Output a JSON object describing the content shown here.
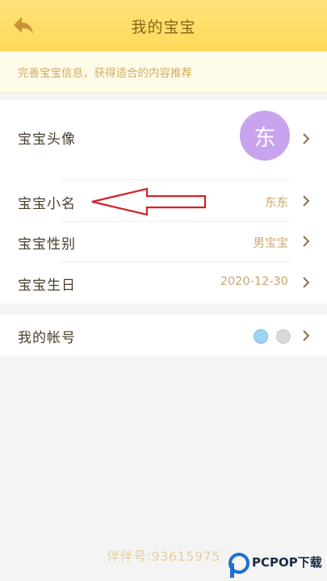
{
  "header": {
    "title": "我的宝宝",
    "back_icon": "back-arrow-icon",
    "background": "#ffd95a"
  },
  "subtitle": "完善宝宝信息，获得适合的内容推荐",
  "profile": {
    "avatar": {
      "label": "宝宝头像",
      "avatar_char": "东",
      "avatar_color": "#c9a4ee"
    },
    "nickname": {
      "label": "宝宝小名",
      "value": "东东"
    },
    "gender": {
      "label": "宝宝性别",
      "value": "男宝宝"
    },
    "birthday": {
      "label": "宝宝生日",
      "value": "2020-12-30"
    }
  },
  "account": {
    "label": "我的帐号",
    "icons": [
      "blue-account-icon",
      "gray-account-icon"
    ]
  },
  "footer": {
    "id_text": "伴伴号:93615975"
  },
  "watermark": {
    "text": "PCPOP下载"
  },
  "annotation": {
    "icon": "red-arrow-icon",
    "color": "#d3222a"
  }
}
